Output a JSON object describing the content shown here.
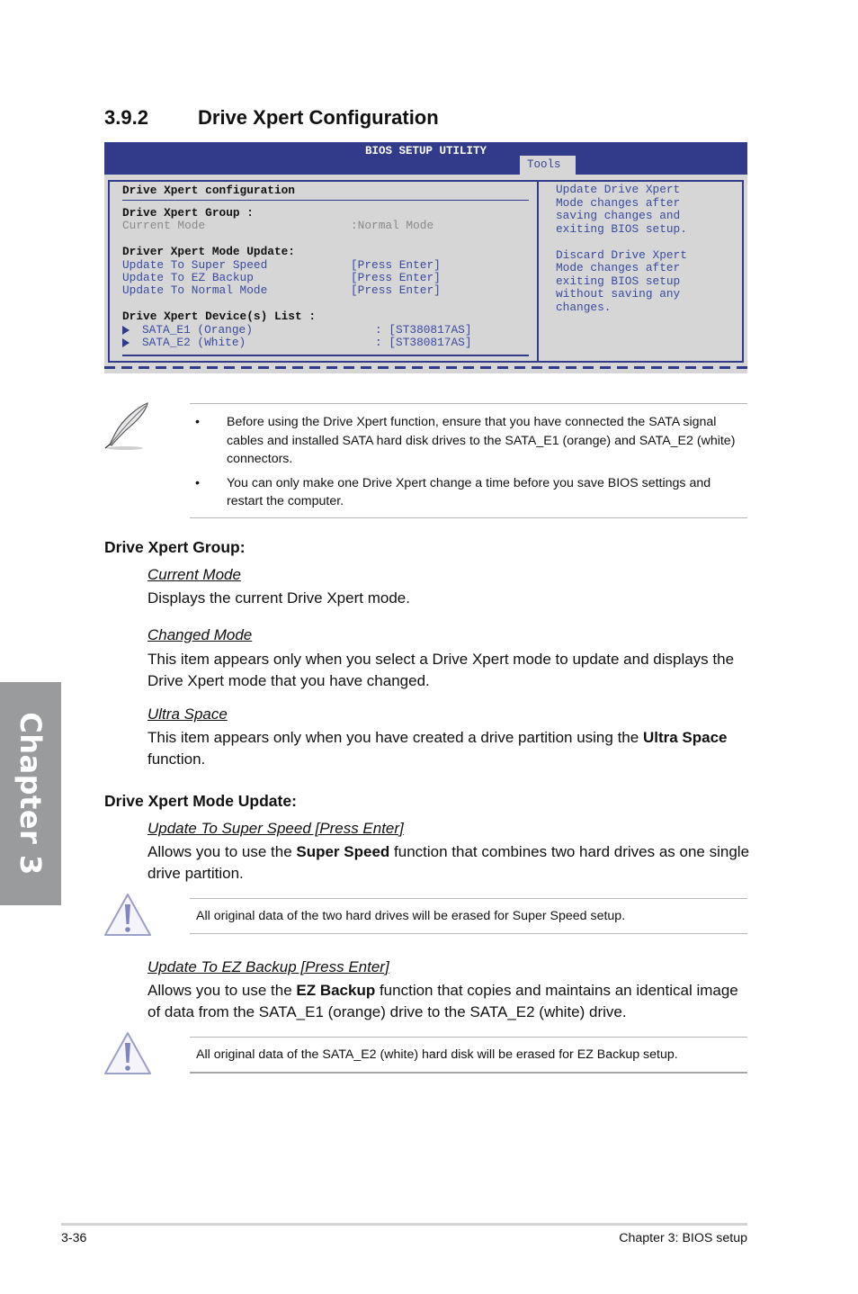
{
  "chapter_tab": "Chapter 3",
  "section": {
    "number": "3.9.2",
    "title": "Drive Xpert Configuration"
  },
  "bios": {
    "title": "BIOS SETUP UTILITY",
    "active_tab": "Tools",
    "left": {
      "heading": "Drive Xpert configuration",
      "group_label": "Drive Xpert Group :",
      "current_mode_label": "Current Mode",
      "current_mode_value": ":Normal Mode",
      "mode_update_label": "Driver Xpert Mode Update:",
      "updates": [
        {
          "label": "Update To Super Speed",
          "value": "[Press Enter]"
        },
        {
          "label": "Update To EZ Backup",
          "value": "[Press Enter]"
        },
        {
          "label": "Update To Normal Mode",
          "value": "[Press Enter]"
        }
      ],
      "device_list_label": "Drive Xpert Device(s) List :",
      "devices": [
        {
          "label": "SATA_E1 (Orange)",
          "value": ": [ST380817AS]"
        },
        {
          "label": "SATA_E2 (White)",
          "value": ": [ST380817AS]"
        }
      ]
    },
    "help": [
      "Update Drive Xpert",
      "Mode changes after",
      "saving changes and",
      "exiting BIOS setup.",
      "",
      "Discard Drive Xpert",
      "Mode changes after",
      "exiting BIOS setup",
      "without saving any",
      "changes."
    ],
    "colors": {
      "header": "#323a8a",
      "panel": "#d6d6d6",
      "item": "#3a4aa0"
    }
  },
  "note": {
    "icon": "feather-pen-icon",
    "bullets": [
      "Before using the Drive Xpert function, ensure that you have connected the SATA signal cables and installed SATA hard disk drives to the SATA_E1 (orange) and SATA_E2 (white) connectors.",
      "You can only make one Drive Xpert change a time before you save BIOS settings and restart the computer."
    ],
    "bullet_char": "•"
  },
  "group_section": {
    "heading": "Drive Xpert Group:",
    "items": [
      {
        "title": "Current Mode",
        "body": "Displays the current Drive Xpert mode."
      },
      {
        "title": "Changed Mode",
        "body": "This item appears only when you select a Drive Xpert mode to update and displays the Drive Xpert mode that you have changed."
      },
      {
        "title": "Ultra Space",
        "body_pre": "This item appears only when you have created a drive partition using the ",
        "body_bold": "Ultra Space",
        "body_post": " function."
      }
    ]
  },
  "mode_section": {
    "heading": "Drive Xpert Mode Update:",
    "items": [
      {
        "title": "Update To Super Speed [Press Enter]",
        "body_pre": "Allows you to use the ",
        "body_bold": "Super Speed",
        "body_post": " function that combines two hard drives as one single drive partition.",
        "warning": "All original data of the two hard drives will be erased for Super Speed setup."
      },
      {
        "title": "Update To EZ Backup [Press Enter]",
        "body_pre": "Allows you to use the ",
        "body_bold": "EZ Backup",
        "body_post": " function that copies and maintains an identical image of data from the SATA_E1 (orange) drive to the SATA_E2 (white) drive.",
        "warning": "All original data of the SATA_E2 (white) hard disk will be erased for EZ Backup setup."
      }
    ]
  },
  "footer": {
    "page": "3-36",
    "chapter": "Chapter 3: BIOS setup"
  }
}
